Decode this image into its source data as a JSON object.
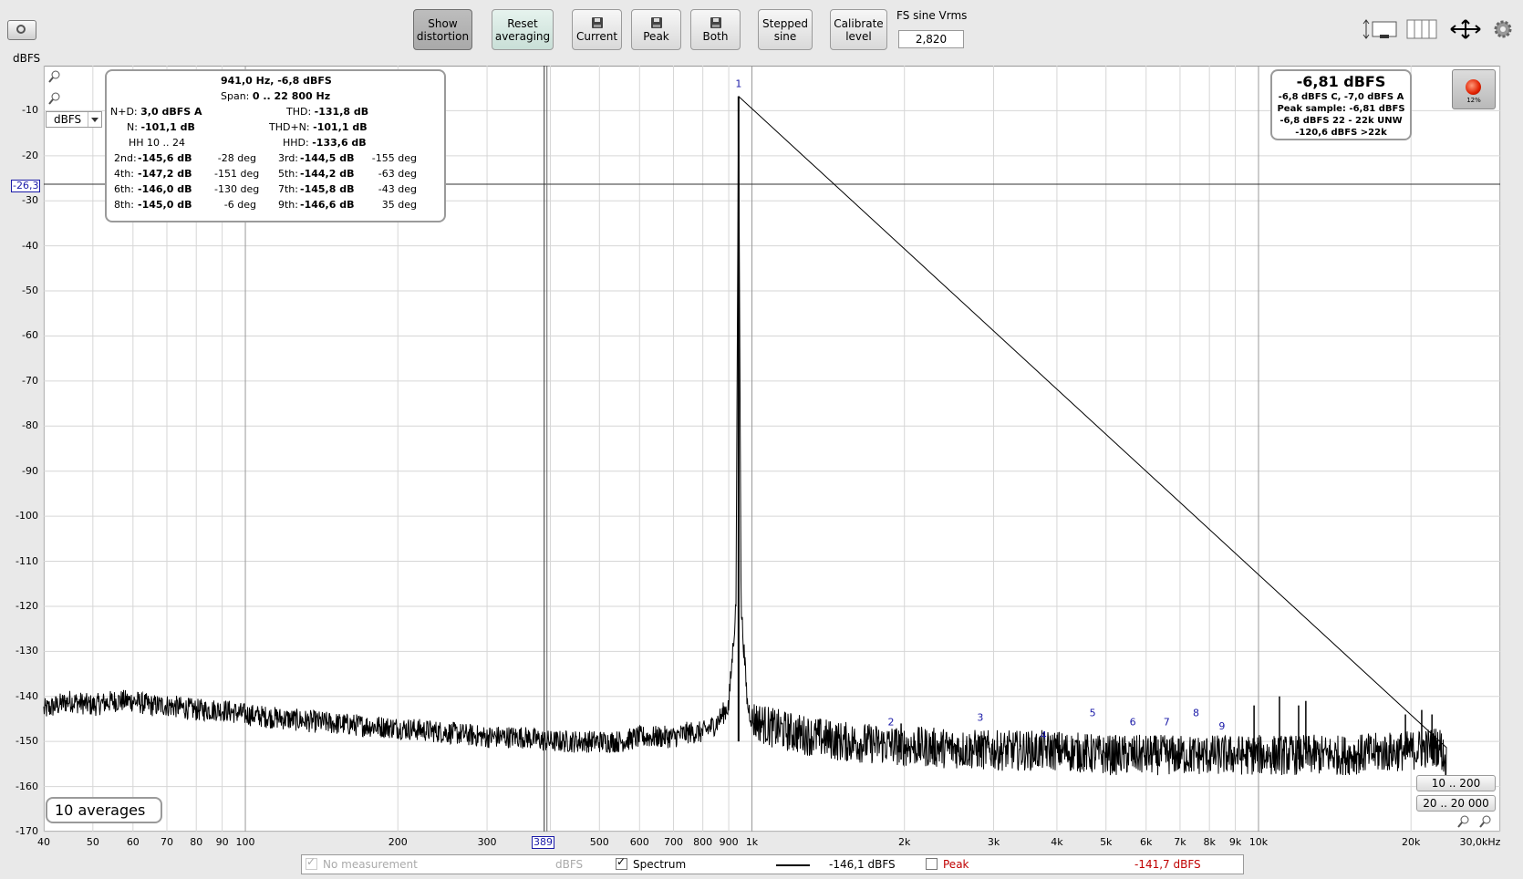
{
  "toolbar": {
    "show_distortion": "Show\ndistortion",
    "reset_averaging": "Reset\naveraging",
    "current": "Current",
    "peak": "Peak",
    "both": "Both",
    "stepped_sine": "Stepped\nsine",
    "calibrate_level": "Calibrate\nlevel",
    "fs_label": "FS sine Vrms",
    "fs_value": "2,820"
  },
  "y_unit": "dBFS",
  "unit_select": "dBFS",
  "cursor_y": "-26,3",
  "cursor_x": "389",
  "info": {
    "header": "941,0 Hz, -6,8 dBFS",
    "span_label": "Span:",
    "span_value": "0 .. 22 800 Hz",
    "nd_label": "N+D:",
    "nd_value": "3,0 dBFS A",
    "thd_label": "THD:",
    "thd_value": "-131,8 dB",
    "n_label": "N:",
    "n_value": "-101,1 dB",
    "thdn_label": "THD+N:",
    "thdn_value": "-101,1 dB",
    "hh_label": "HH 10 .. 24",
    "hhd_label": "HHD:",
    "hhd_value": "-133,6 dB",
    "harmonics": [
      {
        "l1": "2nd:",
        "v1": "-145,6 dB",
        "p1": "-28 deg",
        "l2": "3rd:",
        "v2": "-144,5 dB",
        "p2": "-155 deg"
      },
      {
        "l1": "4th:",
        "v1": "-147,2 dB",
        "p1": "-151 deg",
        "l2": "5th:",
        "v2": "-144,2 dB",
        "p2": "-63 deg"
      },
      {
        "l1": "6th:",
        "v1": "-146,0 dB",
        "p1": "-130 deg",
        "l2": "7th:",
        "v2": "-145,8 dB",
        "p2": "-43 deg"
      },
      {
        "l1": "8th:",
        "v1": "-145,0 dB",
        "p1": "-6 deg",
        "l2": "9th:",
        "v2": "-146,6 dB",
        "p2": "35 deg"
      }
    ]
  },
  "level": {
    "main": "-6,81 dBFS",
    "line1": "-6,8 dBFS C, -7,0 dBFS A",
    "line2": "Peak sample: -6,81 dBFS",
    "line3": "-6,8 dBFS 22 - 22k UNW",
    "line4": "-120,6 dBFS >22k"
  },
  "rec_pct": "12%",
  "averages": "10 averages",
  "range1": "10 .. 200",
  "range2": "20 .. 20 000",
  "legend": {
    "no_measurement": "No measurement",
    "no_measurement_unit": "dBFS",
    "spectrum": "Spectrum",
    "spectrum_value": "-146,1 dBFS",
    "peak": "Peak",
    "peak_value": "-141,7 dBFS"
  },
  "colors": {
    "peak_red": "#c00000",
    "marker_blue": "#1a1aa8",
    "trace": "#000000"
  },
  "chart_data": {
    "type": "line",
    "x_scale": "log",
    "xlim": [
      40,
      30000
    ],
    "ylim": [
      -170,
      0
    ],
    "y_ticks": [
      -10,
      -20,
      -30,
      -40,
      -50,
      -60,
      -70,
      -80,
      -90,
      -100,
      -110,
      -120,
      -130,
      -140,
      -150,
      -160,
      -170
    ],
    "x_tick_values": [
      40,
      50,
      60,
      70,
      80,
      90,
      100,
      200,
      300,
      400,
      500,
      600,
      700,
      800,
      900,
      1000,
      2000,
      3000,
      4000,
      5000,
      6000,
      7000,
      8000,
      9000,
      10000,
      20000
    ],
    "x_tick_labels": [
      "40",
      "50",
      "60",
      "70",
      "80",
      "90",
      "100",
      "200",
      "300",
      "",
      "500",
      "600",
      "700",
      "800",
      "900",
      "1k",
      "2k",
      "3k",
      "4k",
      "5k",
      "6k",
      "7k",
      "8k",
      "9k",
      "10k",
      "20k"
    ],
    "x_end_label": "30,0kHz",
    "grid": true,
    "cursor_hz": 389,
    "cursor_db": -26.3,
    "fundamental": {
      "hz": 941,
      "db": -6.8,
      "label": "1"
    },
    "harmonic_markers": [
      {
        "label": "2",
        "hz": 1882,
        "db": -148
      },
      {
        "label": "3",
        "hz": 2823,
        "db": -147
      },
      {
        "label": "4",
        "hz": 3764,
        "db": -151
      },
      {
        "label": "5",
        "hz": 4705,
        "db": -146
      },
      {
        "label": "6",
        "hz": 5646,
        "db": -148
      },
      {
        "label": "7",
        "hz": 6587,
        "db": -148
      },
      {
        "label": "8",
        "hz": 7528,
        "db": -146
      },
      {
        "label": "9",
        "hz": 8469,
        "db": -149
      }
    ],
    "series": [
      {
        "name": "Spectrum",
        "points": [
          [
            40,
            -143
          ],
          [
            45,
            -141
          ],
          [
            50,
            -142
          ],
          [
            55,
            -141
          ],
          [
            60,
            -141
          ],
          [
            65,
            -142
          ],
          [
            70,
            -142
          ],
          [
            80,
            -143
          ],
          [
            90,
            -143
          ],
          [
            100,
            -144
          ],
          [
            120,
            -145
          ],
          [
            150,
            -146
          ],
          [
            200,
            -147
          ],
          [
            250,
            -148
          ],
          [
            300,
            -149
          ],
          [
            350,
            -149
          ],
          [
            400,
            -150
          ],
          [
            450,
            -150
          ],
          [
            500,
            -150
          ],
          [
            550,
            -150
          ],
          [
            600,
            -149
          ],
          [
            650,
            -149
          ],
          [
            700,
            -149
          ],
          [
            750,
            -148
          ],
          [
            800,
            -148
          ],
          [
            850,
            -146
          ],
          [
            900,
            -142
          ],
          [
            930,
            -120
          ],
          [
            941,
            -6.8
          ],
          [
            952,
            -120
          ],
          [
            980,
            -142
          ],
          [
            1000,
            -145
          ],
          [
            1100,
            -147
          ],
          [
            1200,
            -148
          ],
          [
            1500,
            -150
          ],
          [
            2000,
            -151
          ],
          [
            3000,
            -152
          ],
          [
            4000,
            -152
          ],
          [
            5000,
            -153
          ],
          [
            7000,
            -153
          ],
          [
            10000,
            -153
          ],
          [
            15000,
            -153
          ],
          [
            20000,
            -152
          ],
          [
            22800,
            -151
          ],
          [
            23500,
            -155
          ]
        ],
        "spurs": [
          [
            1970,
            -146
          ],
          [
            9800,
            -142
          ],
          [
            11000,
            -140
          ],
          [
            12000,
            -142
          ],
          [
            12400,
            -141
          ],
          [
            19500,
            -144
          ],
          [
            21000,
            -143
          ],
          [
            22000,
            -144
          ]
        ]
      }
    ]
  }
}
